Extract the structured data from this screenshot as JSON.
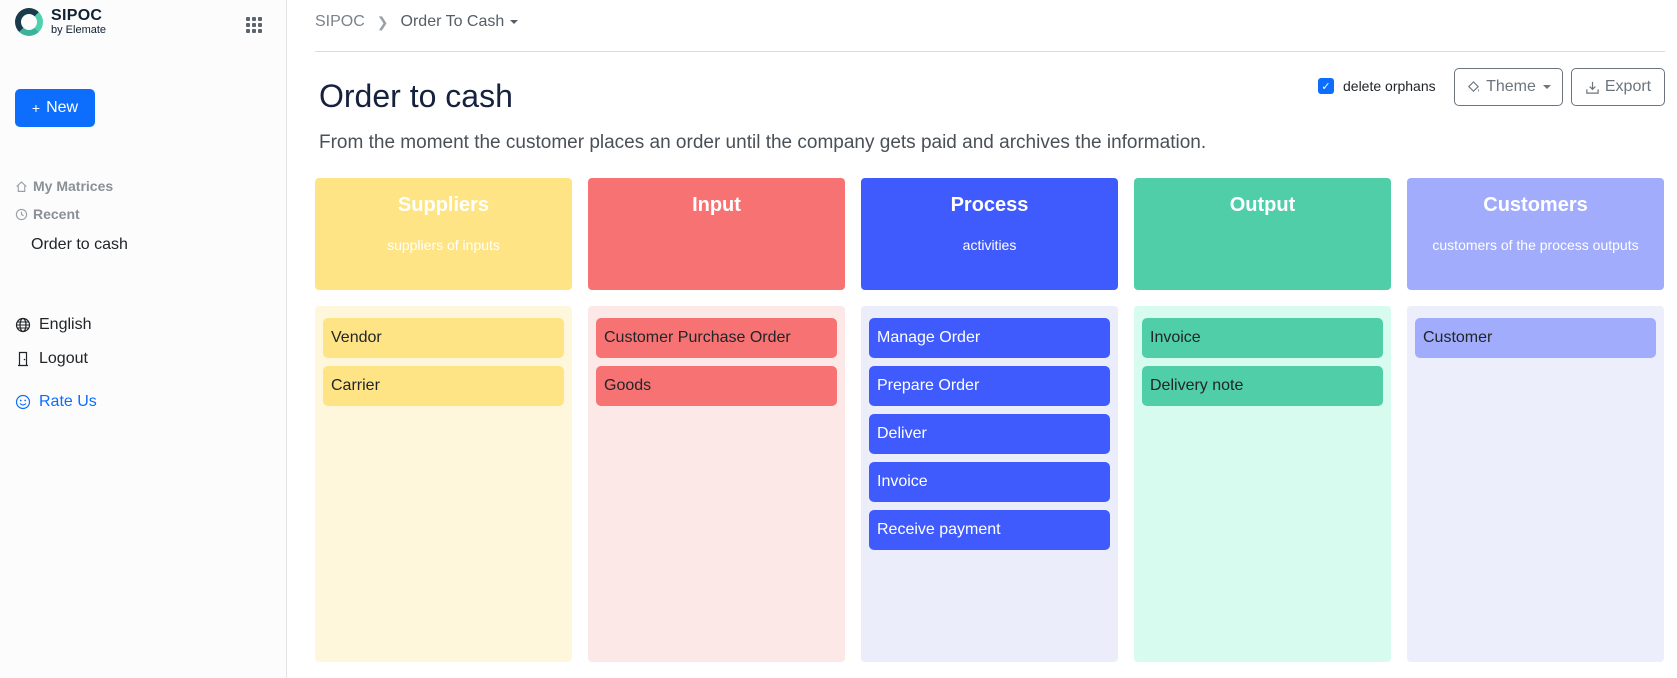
{
  "app": {
    "title": "SIPOC",
    "subtitle": "by Elemate"
  },
  "sidebar": {
    "new_label": "New",
    "my_matrices": "My Matrices",
    "recent": "Recent",
    "recent_item": "Order to cash",
    "language": "English",
    "logout": "Logout",
    "rate_us": "Rate Us"
  },
  "breadcrumb": {
    "root": "SIPOC",
    "current": "Order To Cash"
  },
  "toolbar": {
    "delete_orphans": "delete orphans",
    "delete_orphans_checked": true,
    "theme": "Theme",
    "export": "Export"
  },
  "page": {
    "title": "Order to cash",
    "description": "From the moment the customer places an order until the company gets paid and archives the information."
  },
  "columns": [
    {
      "title": "Suppliers",
      "subtitle": "suppliers of inputs",
      "head_color": "#ffe485",
      "body_color": "#fff7db",
      "card_color": "#ffe485",
      "card_text": "#212529",
      "items": [
        "Vendor",
        "Carrier"
      ]
    },
    {
      "title": "Input",
      "subtitle": "",
      "head_color": "#f77373",
      "body_color": "#fde8e8",
      "card_color": "#f77373",
      "card_text": "#212529",
      "items": [
        "Customer Purchase Order",
        "Goods"
      ]
    },
    {
      "title": "Process",
      "subtitle": "activities",
      "head_color": "#3f5bfd",
      "body_color": "#ebedfb",
      "card_color": "#3f5bfd",
      "card_text": "#ffffff",
      "items": [
        "Manage Order",
        "Prepare Order",
        "Deliver",
        "Invoice",
        "Receive payment"
      ]
    },
    {
      "title": "Output",
      "subtitle": "",
      "head_color": "#4fcea8",
      "body_color": "#d7fbee",
      "card_color": "#4fcea8",
      "card_text": "#212529",
      "items": [
        "Invoice",
        "Delivery note"
      ]
    },
    {
      "title": "Customers",
      "subtitle": "customers of the process outputs",
      "head_color": "#a1acfd",
      "body_color": "#eceefc",
      "card_color": "#a1acfd",
      "card_text": "#212529",
      "items": [
        "Customer"
      ]
    }
  ]
}
